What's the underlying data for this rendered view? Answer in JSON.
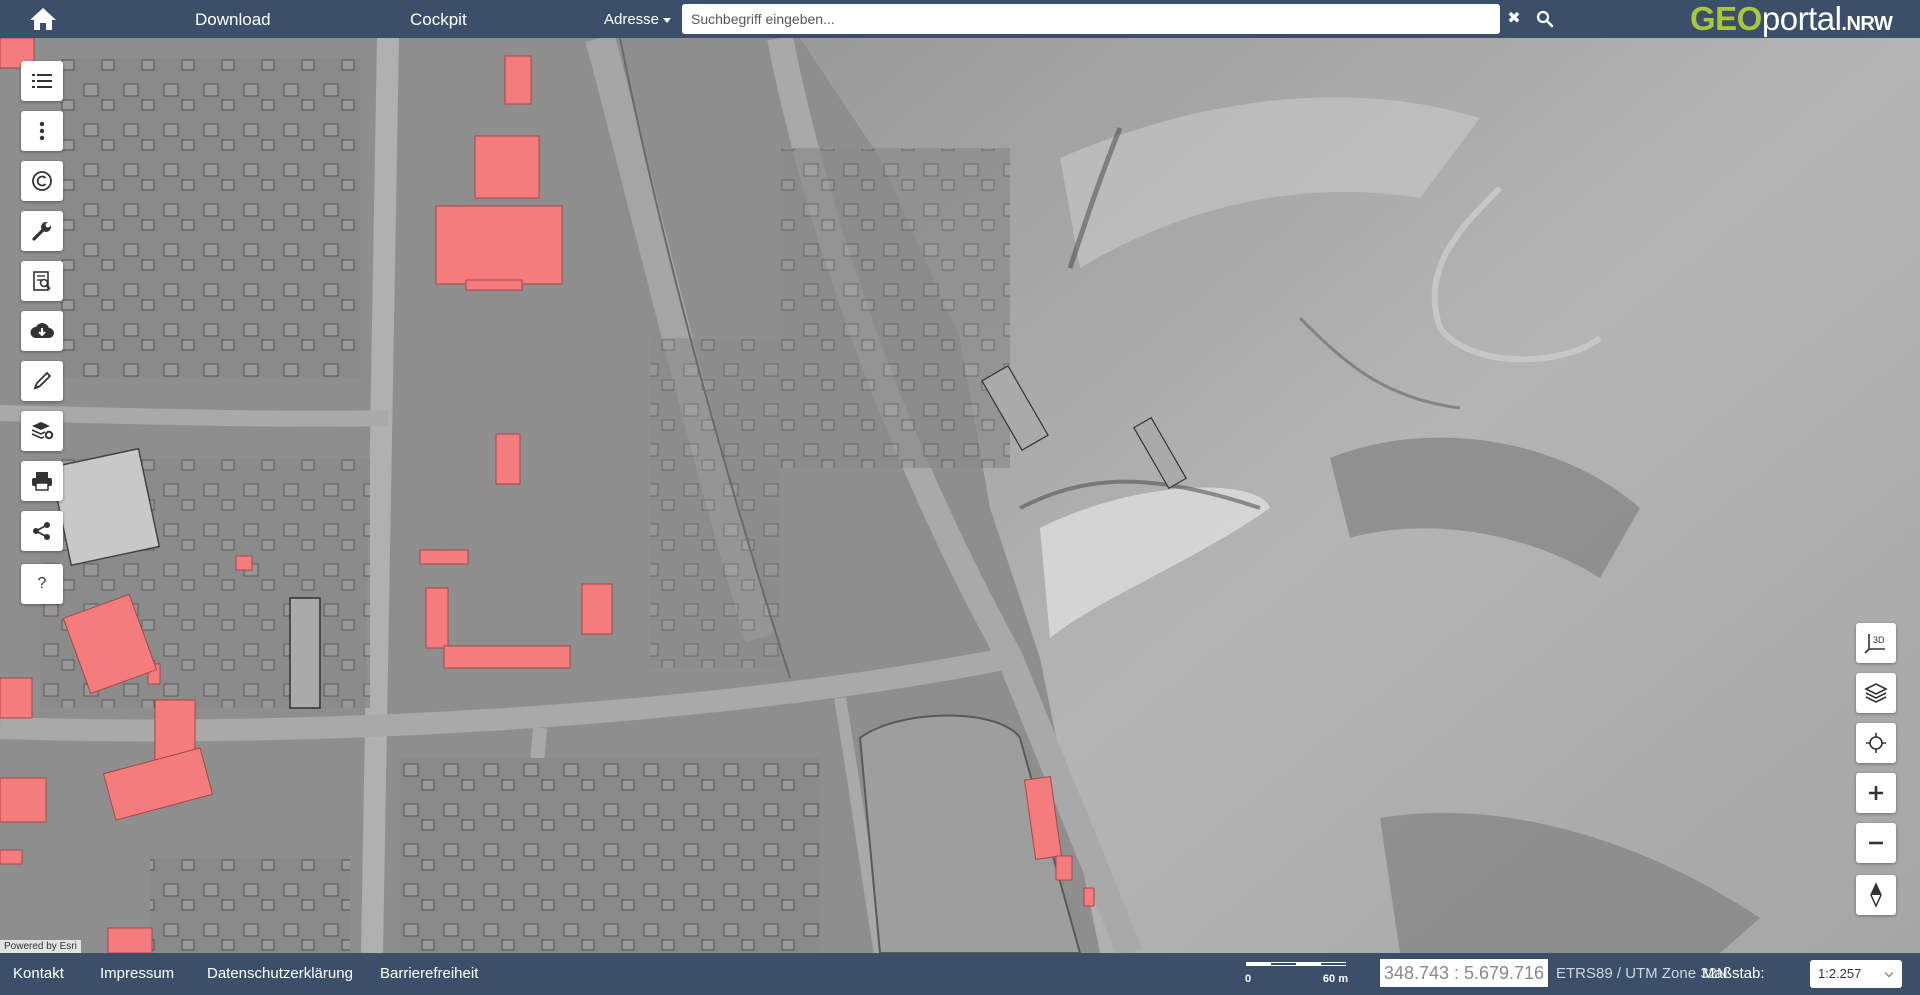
{
  "header": {
    "nav": [
      "Download",
      "Cockpit"
    ],
    "search_type": "Adresse",
    "search_placeholder": "Suchbegriff eingeben...",
    "clear_symbol": "✖",
    "logo": {
      "geo": "GEO",
      "portal": "portal",
      "nrw": ".NRW"
    }
  },
  "left_tools": [
    {
      "icon": "list-icon"
    },
    {
      "icon": "more-vertical-icon"
    },
    {
      "icon": "copyright-icon"
    },
    {
      "icon": "wrench-icon"
    },
    {
      "icon": "document-search-icon"
    },
    {
      "icon": "cloud-download-icon"
    },
    {
      "icon": "pencil-icon"
    },
    {
      "icon": "layers-settings-icon"
    },
    {
      "icon": "printer-icon"
    },
    {
      "icon": "share-icon"
    },
    {
      "icon": "help-icon",
      "text": "?"
    }
  ],
  "right_controls": [
    {
      "icon": "3d-view-icon",
      "text": "3D"
    },
    {
      "icon": "layers-icon"
    },
    {
      "icon": "locate-icon"
    },
    {
      "icon": "zoom-in-icon",
      "text": "+"
    },
    {
      "icon": "zoom-out-icon",
      "text": "−"
    },
    {
      "icon": "compass-icon"
    }
  ],
  "map": {
    "attribution": "Powered by Esri",
    "building_highlight_color": "#f47c7c"
  },
  "footer": {
    "links": [
      "Kontakt",
      "Impressum",
      "Datenschutzerklärung",
      "Barrierefreiheit"
    ],
    "scalebar": {
      "min": "0",
      "max": "60 m"
    },
    "coordinates": "348.743 : 5.679.716",
    "crs": "ETRS89 / UTM Zone 32N",
    "scale_label": "Maßstab:",
    "scale_value": "1:2.257"
  },
  "colors": {
    "bar": "#3b4f6b",
    "accent": "#a8c83a"
  }
}
